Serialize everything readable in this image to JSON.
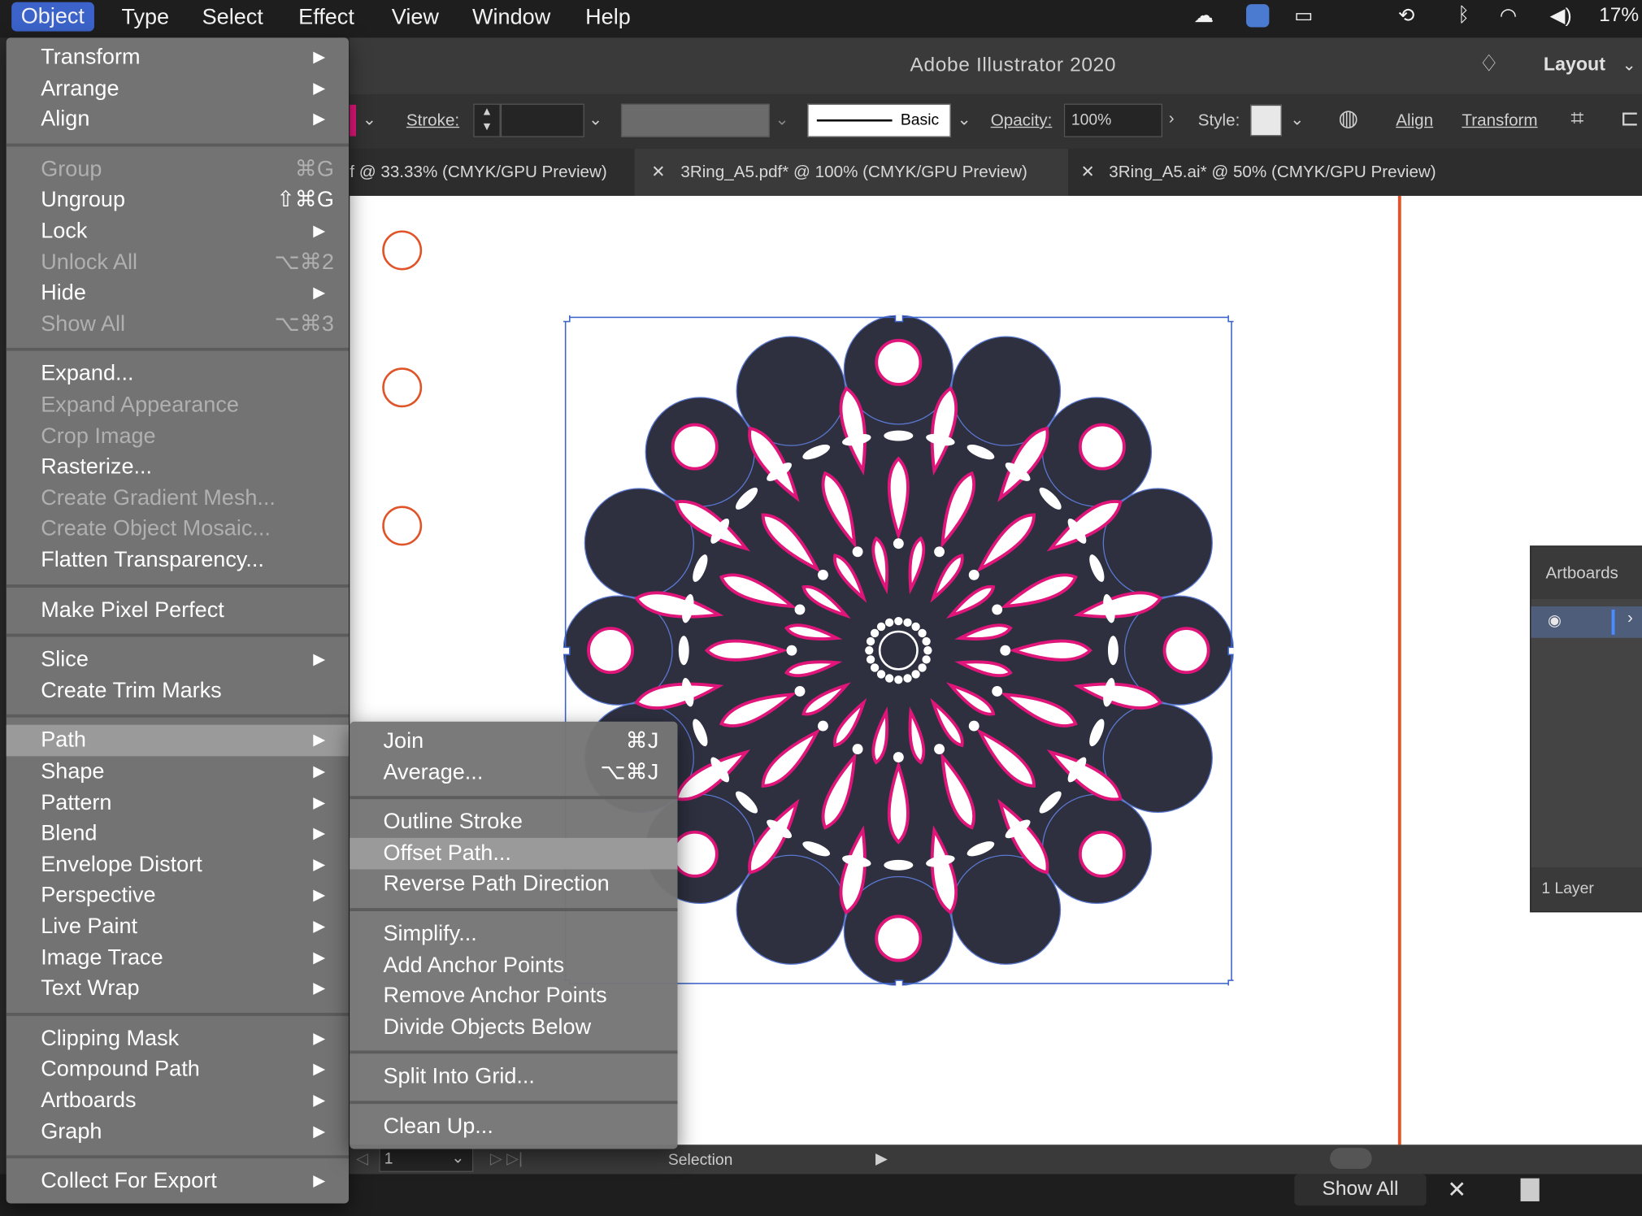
{
  "menubar": {
    "items": [
      "Object",
      "Type",
      "Select",
      "Effect",
      "View",
      "Window",
      "Help"
    ],
    "active": "Object",
    "battery": "17%"
  },
  "app_title": "Adobe Illustrator 2020",
  "workspace": "Layout",
  "control_bar": {
    "stroke_label": "Stroke:",
    "brush": "Basic",
    "opacity_label": "Opacity:",
    "opacity_value": "100%",
    "style_label": "Style:",
    "align": "Align",
    "transform": "Transform"
  },
  "tabs": [
    "f @ 33.33% (CMYK/GPU Preview)",
    "3Ring_A5.pdf* @ 100% (CMYK/GPU Preview)",
    "3Ring_A5.ai* @ 50% (CMYK/GPU Preview)"
  ],
  "object_menu": [
    {
      "label": "Transform",
      "arrow": true
    },
    {
      "label": "Arrange",
      "arrow": true
    },
    {
      "label": "Align",
      "arrow": true
    },
    {
      "sep": true
    },
    {
      "label": "Group",
      "shortcut": "⌘G",
      "disabled": true
    },
    {
      "label": "Ungroup",
      "shortcut": "⇧⌘G"
    },
    {
      "label": "Lock",
      "arrow": true
    },
    {
      "label": "Unlock All",
      "shortcut": "⌥⌘2",
      "disabled": true
    },
    {
      "label": "Hide",
      "arrow": true
    },
    {
      "label": "Show All",
      "shortcut": "⌥⌘3",
      "disabled": true
    },
    {
      "sep": true
    },
    {
      "label": "Expand..."
    },
    {
      "label": "Expand Appearance",
      "disabled": true
    },
    {
      "label": "Crop Image",
      "disabled": true
    },
    {
      "label": "Rasterize..."
    },
    {
      "label": "Create Gradient Mesh...",
      "disabled": true
    },
    {
      "label": "Create Object Mosaic...",
      "disabled": true
    },
    {
      "label": "Flatten Transparency..."
    },
    {
      "sep": true
    },
    {
      "label": "Make Pixel Perfect"
    },
    {
      "sep": true
    },
    {
      "label": "Slice",
      "arrow": true
    },
    {
      "label": "Create Trim Marks"
    },
    {
      "sep": true
    },
    {
      "label": "Path",
      "arrow": true,
      "highlight": true
    },
    {
      "label": "Shape",
      "arrow": true
    },
    {
      "label": "Pattern",
      "arrow": true
    },
    {
      "label": "Blend",
      "arrow": true
    },
    {
      "label": "Envelope Distort",
      "arrow": true
    },
    {
      "label": "Perspective",
      "arrow": true
    },
    {
      "label": "Live Paint",
      "arrow": true
    },
    {
      "label": "Image Trace",
      "arrow": true
    },
    {
      "label": "Text Wrap",
      "arrow": true
    },
    {
      "sep": true
    },
    {
      "label": "Clipping Mask",
      "arrow": true
    },
    {
      "label": "Compound Path",
      "arrow": true
    },
    {
      "label": "Artboards",
      "arrow": true
    },
    {
      "label": "Graph",
      "arrow": true
    },
    {
      "sep": true
    },
    {
      "label": "Collect For Export",
      "arrow": true
    }
  ],
  "path_submenu": [
    {
      "label": "Join",
      "shortcut": "⌘J"
    },
    {
      "label": "Average...",
      "shortcut": "⌥⌘J"
    },
    {
      "sep": true
    },
    {
      "label": "Outline Stroke"
    },
    {
      "label": "Offset Path...",
      "highlight": true
    },
    {
      "label": "Reverse Path Direction"
    },
    {
      "sep": true
    },
    {
      "label": "Simplify..."
    },
    {
      "label": "Add Anchor Points"
    },
    {
      "label": "Remove Anchor Points"
    },
    {
      "label": "Divide Objects Below"
    },
    {
      "sep": true
    },
    {
      "label": "Split Into Grid..."
    },
    {
      "sep": true
    },
    {
      "label": "Clean Up..."
    }
  ],
  "artboards_panel": {
    "title": "Artboards",
    "footer": "1 Layer"
  },
  "status": {
    "artboard": "1",
    "tool": "Selection"
  },
  "dock": {
    "show_all": "Show All"
  },
  "colors": {
    "accent": "#3b63c9",
    "artboard_edge": "#e0542a",
    "mandala_fill": "#2e3040",
    "mandala_accent": "#e0157a"
  }
}
